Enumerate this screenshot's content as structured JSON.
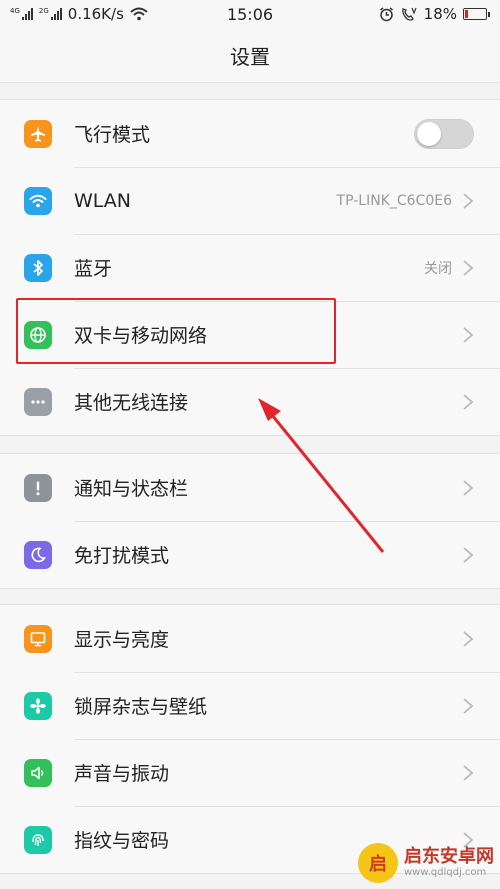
{
  "status": {
    "left_tag1": "4G",
    "left_tag2": "2G",
    "speed": "0.16K/s",
    "time": "15:06",
    "battery": "18%",
    "battery_level": 0.18
  },
  "header": {
    "title": "设置"
  },
  "groups": [
    {
      "items": [
        {
          "label": "飞行模式",
          "icon": "airplane-icon",
          "color": "#f7941d",
          "control": "toggle",
          "on": false
        },
        {
          "label": "WLAN",
          "icon": "wifi-icon",
          "color": "#2aa5ea",
          "value": "TP-LINK_C6C0E6"
        },
        {
          "label": "蓝牙",
          "icon": "bluetooth-icon",
          "color": "#2aa5ea",
          "value": "关闭"
        },
        {
          "label": "双卡与移动网络",
          "icon": "globe-icon",
          "color": "#33c05a"
        },
        {
          "label": "其他无线连接",
          "icon": "more-dots-icon",
          "color": "#9aa0a6"
        }
      ]
    },
    {
      "items": [
        {
          "label": "通知与状态栏",
          "icon": "notification-icon",
          "color": "#8e9399"
        },
        {
          "label": "免打扰模式",
          "icon": "moon-icon",
          "color": "#7b6ae8"
        }
      ]
    },
    {
      "items": [
        {
          "label": "显示与亮度",
          "icon": "display-icon",
          "color": "#f7941d"
        },
        {
          "label": "锁屏杂志与壁纸",
          "icon": "flower-icon",
          "color": "#1ec9a8"
        },
        {
          "label": "声音与振动",
          "icon": "speaker-icon",
          "color": "#33c05a"
        },
        {
          "label": "指纹与密码",
          "icon": "fingerprint-icon",
          "color": "#1ec9a8"
        }
      ]
    }
  ],
  "watermark": {
    "logo": "启",
    "title": "启东安卓网",
    "url": "www.qdlqdj.com"
  },
  "colors": {
    "highlight": "#e2252b"
  }
}
